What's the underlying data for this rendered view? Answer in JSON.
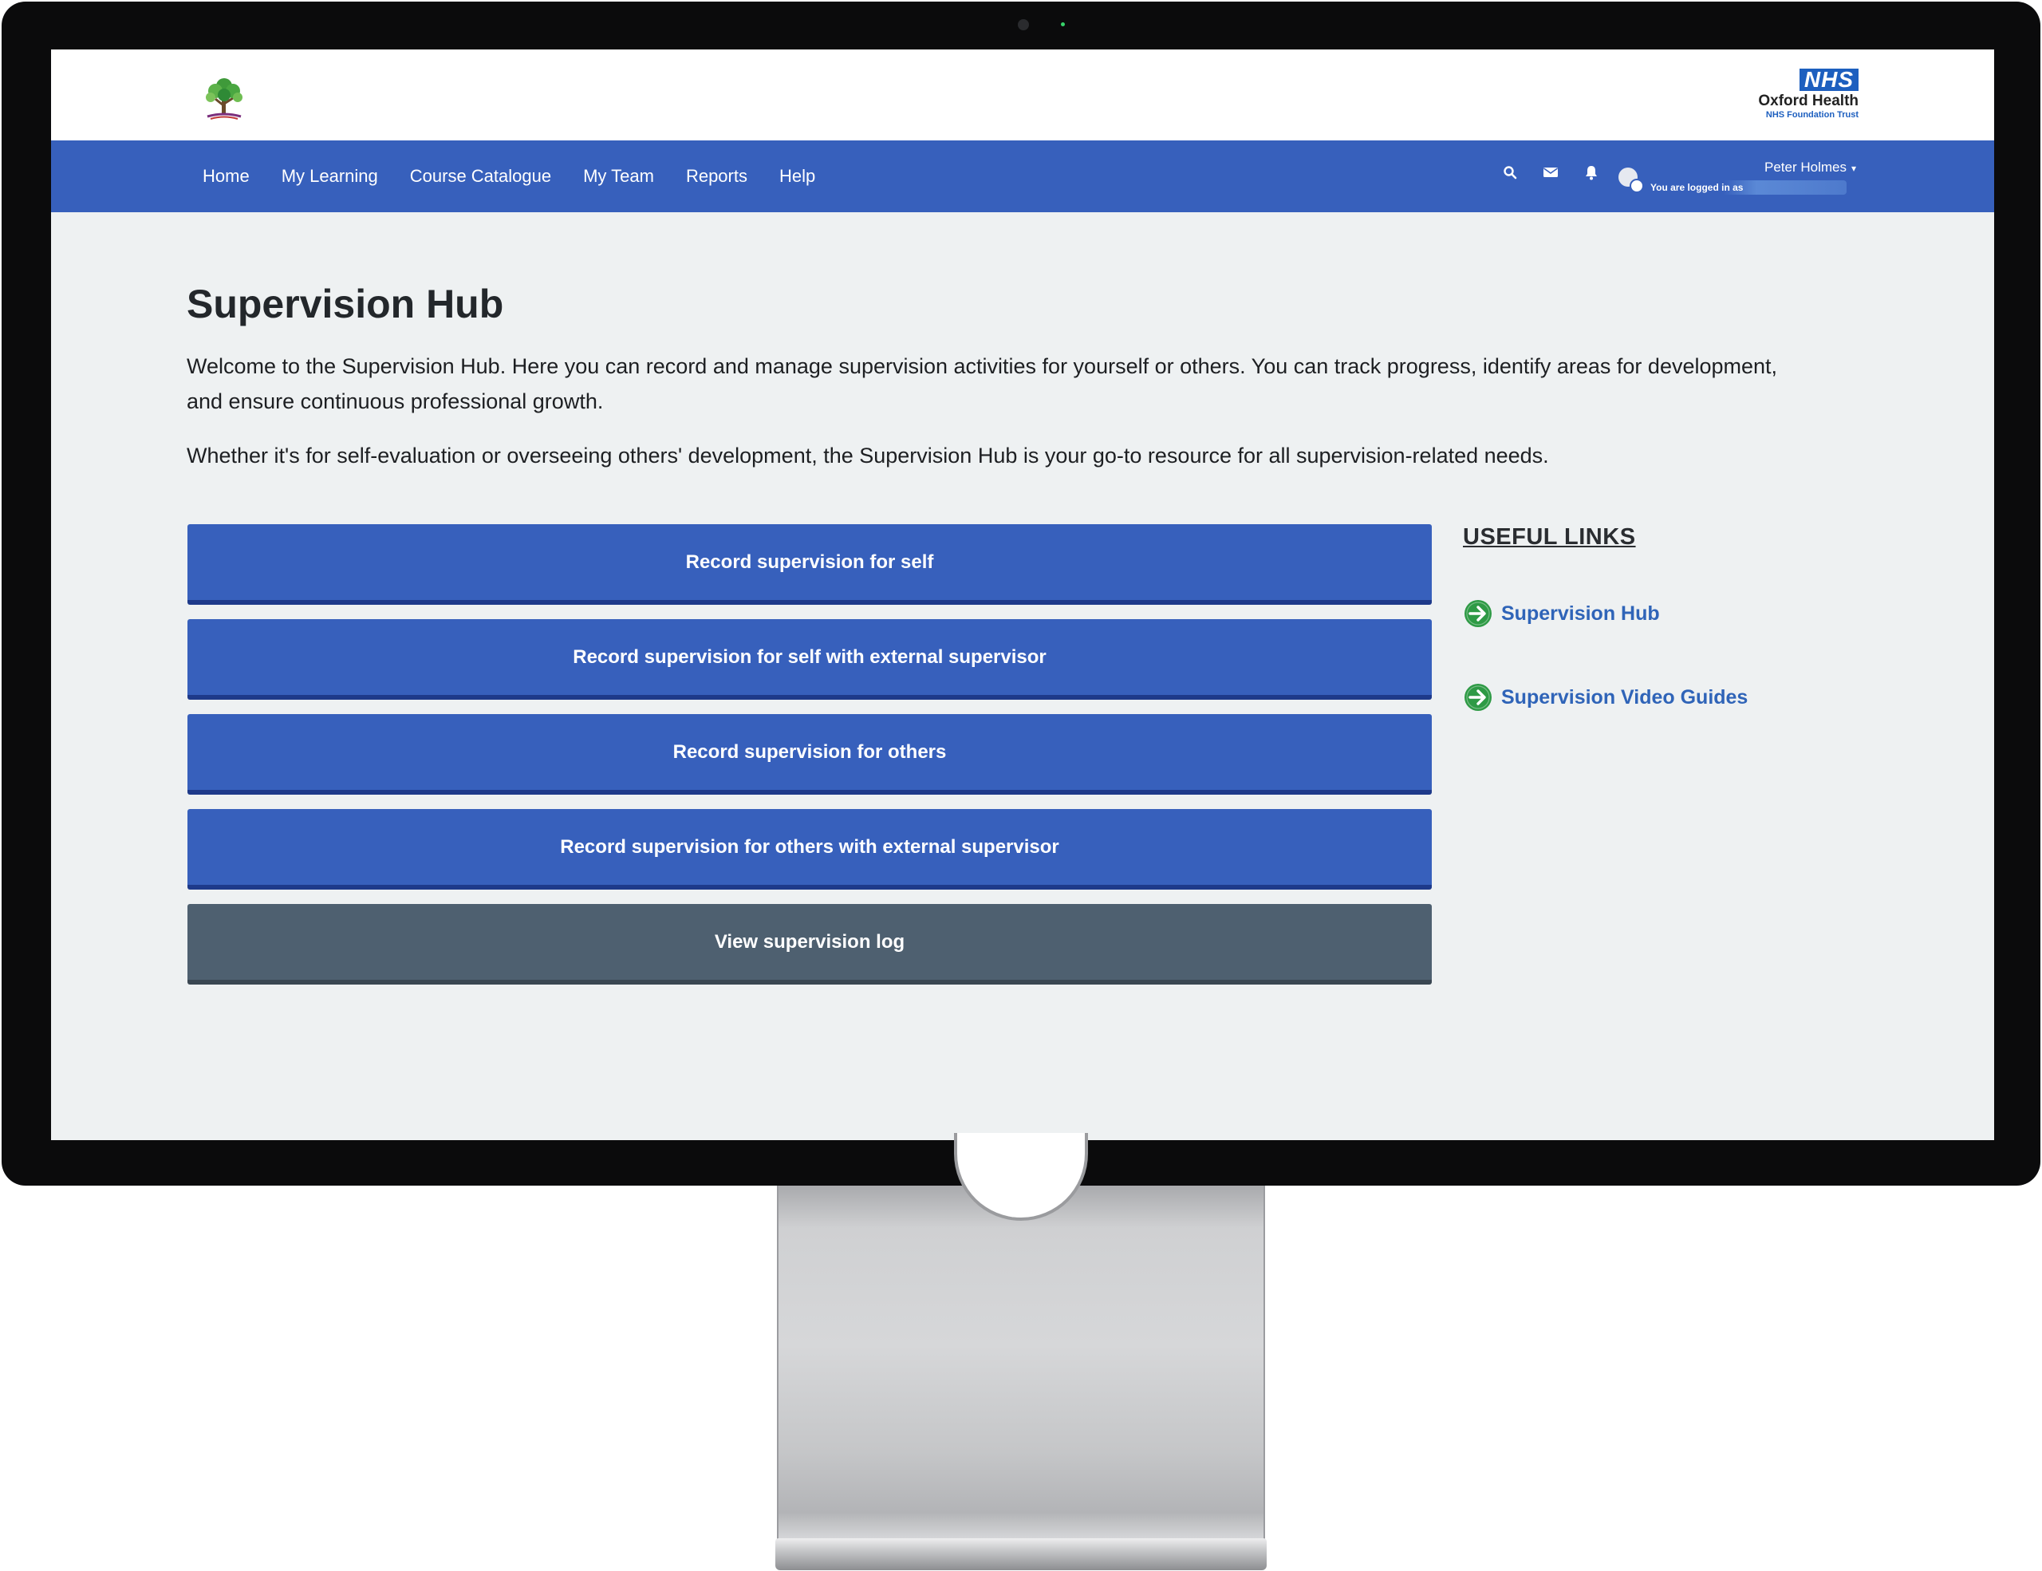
{
  "header": {
    "site_logo_icon": "tree-logo-icon",
    "nhs_badge": "NHS",
    "org_name": "Oxford Health",
    "trust_name": "NHS Foundation Trust"
  },
  "nav": {
    "items": [
      {
        "label": "Home"
      },
      {
        "label": "My Learning"
      },
      {
        "label": "Course Catalogue"
      },
      {
        "label": "My Team"
      },
      {
        "label": "Reports"
      },
      {
        "label": "Help"
      }
    ],
    "icons": [
      "search-icon",
      "mail-icon",
      "bell-icon"
    ],
    "user": {
      "name": "Peter Holmes",
      "logged_in_text": "You are logged in as"
    },
    "color": "#3760bc"
  },
  "main": {
    "title": "Supervision Hub",
    "intro": "Welcome to the Supervision Hub. Here you can record and manage supervision activities for yourself or others. You can track progress, identify areas for development, and ensure continuous professional growth.",
    "intro2": "Whether it's for self-evaluation or overseeing others' development, the Supervision Hub is your go-to resource for all supervision-related needs.",
    "actions": [
      {
        "label": "Record supervision for self"
      },
      {
        "label": "Record supervision for self with external supervisor"
      },
      {
        "label": "Record supervision for others"
      },
      {
        "label": "Record supervision for others with external supervisor"
      },
      {
        "label": "View supervision log"
      }
    ]
  },
  "useful_links": {
    "title": "USEFUL LINKS",
    "links": [
      {
        "label": "Supervision Hub",
        "icon": "arrow-right-circle-icon"
      },
      {
        "label": "Supervision Video Guides",
        "icon": "arrow-right-circle-icon"
      }
    ],
    "icon_color": "#2e9a45"
  }
}
